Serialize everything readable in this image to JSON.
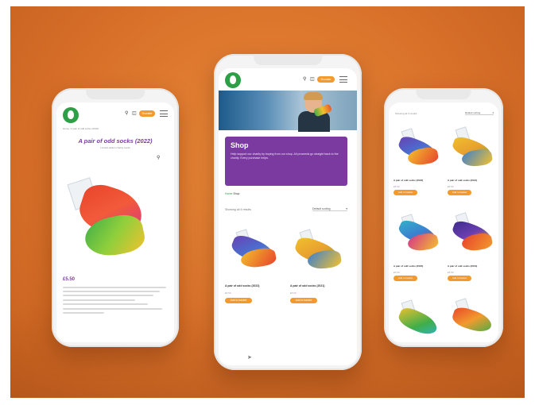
{
  "left_phone": {
    "breadcrumb": "Home / A pair of odd socks (2022)",
    "product_title": "A pair of odd socks (2022)",
    "subtitle": "Limited edition charity socks",
    "price": "£5.50"
  },
  "center_phone": {
    "donate_label": "Donate",
    "shop_title": "Shop",
    "shop_description": "Help support our charity by buying from our shop. All proceeds go straight back to the charity. Every purchase helps.",
    "breadcrumb_home": "Home",
    "breadcrumb_current": "Shop",
    "results_text": "Showing all 4 results",
    "sort_label": "Default sorting",
    "products": [
      {
        "name": "A pair of odd socks (2022)",
        "price": "£5.50",
        "button": "Add to basket"
      },
      {
        "name": "A pair of odd socks (2021)",
        "price": "£5.50",
        "button": "Add to basket"
      }
    ]
  },
  "right_phone": {
    "results_text": "Showing all 4 results",
    "sort_label": "Default sorting",
    "products": [
      {
        "name": "A pair of odd socks (2022)",
        "price": "£5.50",
        "button": "Add to basket"
      },
      {
        "name": "A pair of odd socks (2021)",
        "price": "£5.50",
        "button": "Add to basket"
      },
      {
        "name": "A pair of odd socks (2020)",
        "price": "£5.50",
        "button": "Add to basket"
      },
      {
        "name": "A pair of odd socks (2019)",
        "price": "£5.50",
        "button": "Add to basket"
      }
    ]
  },
  "colors": {
    "background": "#d9712a",
    "accent_purple": "#7b3aa0",
    "button_orange": "#f29a2e",
    "logo_green": "#2e9e47"
  },
  "icons": [
    "logo-icon",
    "search-icon",
    "basket-icon",
    "menu-icon"
  ]
}
